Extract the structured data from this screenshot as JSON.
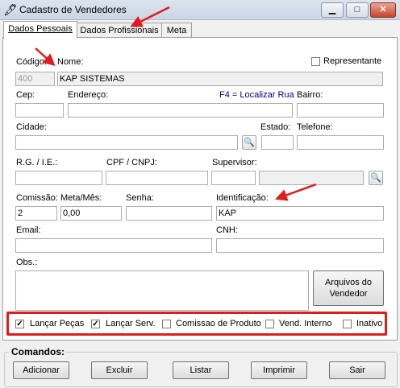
{
  "window": {
    "title": "Cadastro de Vendedores",
    "minimize_glyph": "▁",
    "maximize_glyph": "□",
    "close_glyph": "✕",
    "app_icon_glyph": "🖋"
  },
  "tabs": [
    {
      "label": "Dados Pessoais",
      "active": true
    },
    {
      "label": "Dados Profissionais",
      "active": false
    },
    {
      "label": "Meta",
      "active": false
    }
  ],
  "form": {
    "codigo_label": "Código:",
    "codigo_value": "400",
    "nome_label": "Nome:",
    "nome_value": "KAP SISTEMAS",
    "representante_label": "Representante",
    "representante_checked": false,
    "cep_label": "Cep:",
    "cep_value": "",
    "endereco_label": "Endereço:",
    "endereco_value": "",
    "localizar_hint": "F4 = Localizar Rua",
    "bairro_label": "Bairro:",
    "bairro_value": "",
    "cidade_label": "Cidade:",
    "cidade_value": "",
    "estado_label": "Estado:",
    "estado_value": "",
    "telefone_label": "Telefone:",
    "telefone_value": "",
    "rg_label": "R.G. / I.E.:",
    "rg_value": "",
    "cpf_label": "CPF / CNPJ:",
    "cpf_value": "",
    "supervisor_label": "Supervisor:",
    "supervisor_code": "",
    "supervisor_name": "",
    "comissao_label": "Comissão:",
    "comissao_value": "2",
    "meta_label": "Meta/Mês:",
    "meta_value": "0,00",
    "senha_label": "Senha:",
    "senha_value": "",
    "identificacao_label": "Identificação:",
    "identificacao_value": "KAP",
    "email_label": "Email:",
    "email_value": "",
    "cnh_label": "CNH:",
    "cnh_value": "",
    "obs_label": "Obs.:",
    "obs_value": "",
    "arquivos_button": "Arquivos do Vendedor",
    "lookup_icon": "🔍"
  },
  "options": [
    {
      "label": "Lançar Peças",
      "checked": true
    },
    {
      "label": "Lançar Serv.",
      "checked": true
    },
    {
      "label": "Comissao de Produto",
      "checked": false
    },
    {
      "label": "Vend. Interno",
      "checked": false
    },
    {
      "label": "Inativo",
      "checked": false
    }
  ],
  "check_glyph": "✓",
  "commands": {
    "group_label": "Comandos:",
    "adicionar": "Adicionar",
    "excluir": "Excluir",
    "listar": "Listar",
    "imprimir": "Imprimir",
    "sair": "Sair"
  },
  "colors": {
    "annotation_red": "#e11c1c",
    "hint_blue": "#000080"
  }
}
